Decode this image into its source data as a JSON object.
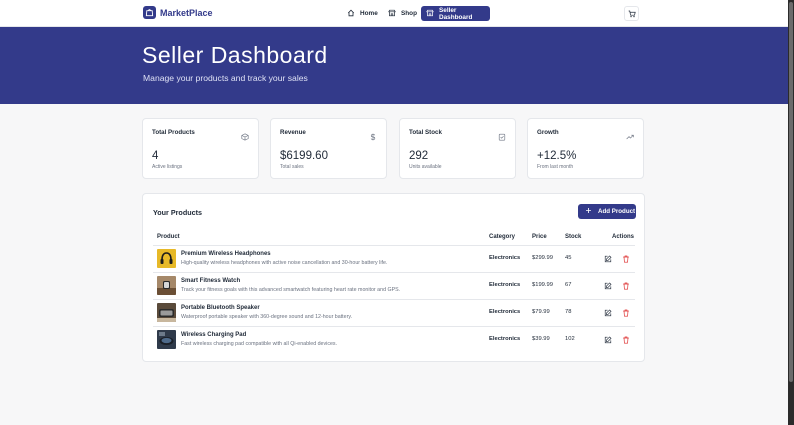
{
  "brand": {
    "name": "MarketPlace"
  },
  "nav": {
    "home": "Home",
    "shop": "Shop",
    "seller": "Seller Dashboard"
  },
  "hero": {
    "title": "Seller Dashboard",
    "subtitle": "Manage your products and track your sales"
  },
  "stats": [
    {
      "title": "Total Products",
      "value": "4",
      "note": "Active listings",
      "icon": "box-icon"
    },
    {
      "title": "Revenue",
      "value": "$6199.60",
      "note": "Total sales",
      "icon": "dollar-icon"
    },
    {
      "title": "Total Stock",
      "value": "292",
      "note": "Units available",
      "icon": "clipboard-icon"
    },
    {
      "title": "Growth",
      "value": "+12.5%",
      "note": "From last month",
      "icon": "trending-up-icon"
    }
  ],
  "products": {
    "title": "Your Products",
    "add_label": "Add Product",
    "columns": {
      "product": "Product",
      "category": "Category",
      "price": "Price",
      "stock": "Stock",
      "actions": "Actions"
    },
    "rows": [
      {
        "name": "Premium Wireless Headphones",
        "desc": "High-quality wireless headphones with active noise cancellation and 30-hour battery life.",
        "category": "Electronics",
        "price": "$299.99",
        "stock": "45"
      },
      {
        "name": "Smart Fitness Watch",
        "desc": "Track your fitness goals with this advanced smartwatch featuring heart rate monitor and GPS.",
        "category": "Electronics",
        "price": "$199.99",
        "stock": "67"
      },
      {
        "name": "Portable Bluetooth Speaker",
        "desc": "Waterproof portable speaker with 360-degree sound and 12-hour battery.",
        "category": "Electronics",
        "price": "$79.99",
        "stock": "78"
      },
      {
        "name": "Wireless Charging Pad",
        "desc": "Fast wireless charging pad compatible with all Qi-enabled devices.",
        "category": "Electronics",
        "price": "$39.99",
        "stock": "102"
      }
    ]
  },
  "colors": {
    "brand": "#333a8a",
    "danger": "#dc2626",
    "border": "#e5e7eb"
  }
}
